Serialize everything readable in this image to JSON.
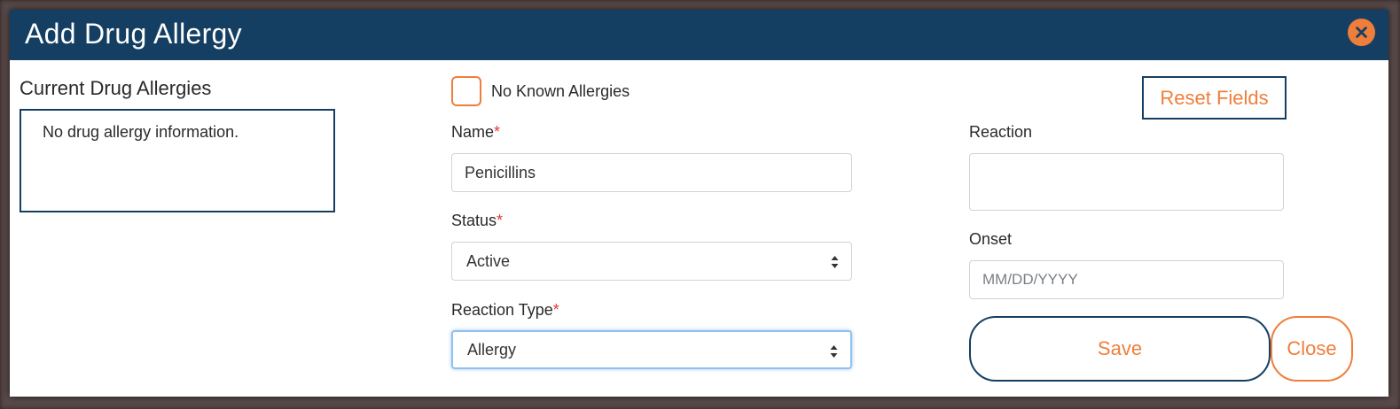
{
  "dialog": {
    "title": "Add Drug Allergy",
    "close_icon": "close-icon"
  },
  "current_allergies": {
    "heading": "Current Drug Allergies",
    "empty_text": "No drug allergy information."
  },
  "no_known_allergies": {
    "label": "No Known Allergies",
    "checked": false
  },
  "fields": {
    "name": {
      "label": "Name",
      "required_mark": "*",
      "value": "Penicillins"
    },
    "status": {
      "label": "Status",
      "required_mark": "*",
      "value": "Active"
    },
    "reaction_type": {
      "label": "Reaction Type",
      "required_mark": "*",
      "value": "Allergy"
    },
    "reaction": {
      "label": "Reaction",
      "value": ""
    },
    "onset": {
      "label": "Onset",
      "placeholder": "MM/DD/YYYY",
      "value": ""
    }
  },
  "buttons": {
    "reset": "Reset Fields",
    "save": "Save",
    "close": "Close"
  },
  "colors": {
    "header": "#153f62",
    "accent": "#f07e3b",
    "required": "#e23a3a"
  }
}
